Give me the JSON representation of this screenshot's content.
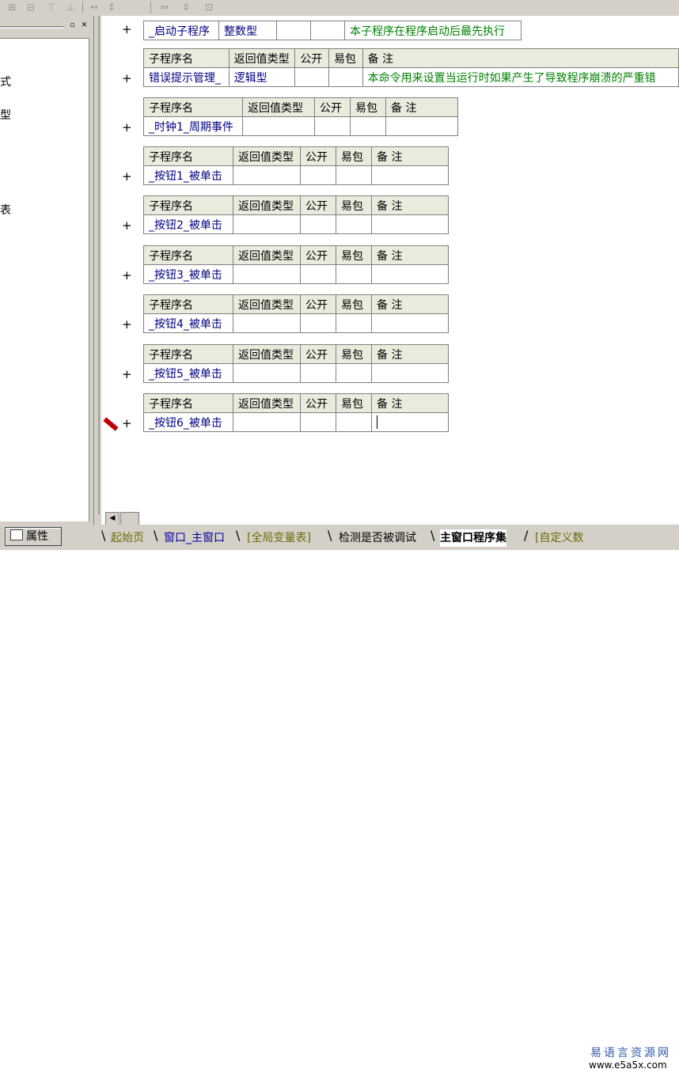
{
  "toolbar": {
    "icons": [
      "align-left-icon",
      "align-center-icon",
      "align-top-icon",
      "align-middle-icon",
      "spacing-h-icon",
      "spacing-v-icon",
      "width-icon",
      "height-icon",
      "size-icon"
    ]
  },
  "left_panel": {
    "glyphs": [
      "式",
      "型",
      "表"
    ]
  },
  "editor": {
    "first_row": {
      "name": "_启动子程序",
      "type": "整数型",
      "remark": "本子程序在程序启动后最先执行"
    },
    "header": {
      "name": "子程序名",
      "return_type": "返回值类型",
      "public": "公开",
      "easy_pack": "易包",
      "remark": "备 注"
    },
    "procedures": [
      {
        "name": "错误提示管理_",
        "type": "逻辑型",
        "remark": "本命令用来设置当运行时如果产生了导致程序崩溃的严重错"
      },
      {
        "name": "_时钟1_周期事件",
        "type": "",
        "remark": ""
      },
      {
        "name": "_按钮1_被单击",
        "type": "",
        "remark": ""
      },
      {
        "name": "_按钮2_被单击",
        "type": "",
        "remark": ""
      },
      {
        "name": "_按钮3_被单击",
        "type": "",
        "remark": ""
      },
      {
        "name": "_按钮4_被单击",
        "type": "",
        "remark": ""
      },
      {
        "name": "_按钮5_被单击",
        "type": "",
        "remark": ""
      },
      {
        "name": "_按钮6_被单击",
        "type": "",
        "remark": ""
      }
    ],
    "plus": "+"
  },
  "bottom": {
    "properties_button": "属性",
    "tabs": [
      {
        "label": "起始页",
        "style": "dim"
      },
      {
        "label": "窗口_主窗口",
        "style": "link"
      },
      {
        "label": "[全局变量表]",
        "style": "dim"
      },
      {
        "label": "检测是否被调试",
        "style": "normal"
      },
      {
        "label": "主窗口程序集",
        "style": "active"
      },
      {
        "label": "[自定义数",
        "style": "dim"
      }
    ],
    "watermark_title": "易语言资源网",
    "watermark_url": "www.e5a5x.com"
  }
}
